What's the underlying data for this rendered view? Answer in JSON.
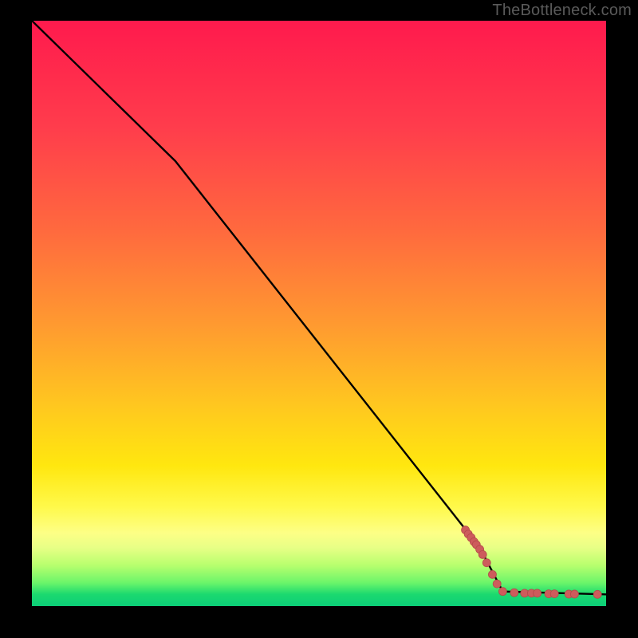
{
  "watermark": "TheBottleneck.com",
  "colors": {
    "line": "#000000",
    "marker_fill": "#cd5c5c",
    "marker_stroke": "#b54a4a",
    "bg_top": "#ff1a4d",
    "bg_mid": "#ffe70f",
    "bg_bottom": "#0cce78"
  },
  "chart_data": {
    "type": "line",
    "title": "",
    "xlabel": "",
    "ylabel": "",
    "xlim": [
      0,
      100
    ],
    "ylim": [
      0,
      100
    ],
    "grid": false,
    "legend": false,
    "series": [
      {
        "name": "curve",
        "x": [
          0,
          25,
          78,
          82,
          100
        ],
        "y": [
          100,
          76,
          10,
          2.5,
          2
        ],
        "note": "piecewise: steeper 0–25, linear 25–78, short arc 78–82, flat 82–100"
      }
    ],
    "markers": {
      "name": "highlighted-points",
      "color": "#cd5c5c",
      "points": [
        {
          "x": 75.5,
          "y": 13.0,
          "r": 5
        },
        {
          "x": 76.0,
          "y": 12.3,
          "r": 5
        },
        {
          "x": 76.5,
          "y": 11.7,
          "r": 5
        },
        {
          "x": 77.0,
          "y": 11.0,
          "r": 5
        },
        {
          "x": 77.4,
          "y": 10.5,
          "r": 5
        },
        {
          "x": 78.0,
          "y": 9.7,
          "r": 5
        },
        {
          "x": 78.5,
          "y": 8.8,
          "r": 5
        },
        {
          "x": 79.2,
          "y": 7.4,
          "r": 5
        },
        {
          "x": 80.2,
          "y": 5.4,
          "r": 5
        },
        {
          "x": 81.0,
          "y": 3.8,
          "r": 5
        },
        {
          "x": 82.0,
          "y": 2.5,
          "r": 5
        },
        {
          "x": 84.0,
          "y": 2.3,
          "r": 5
        },
        {
          "x": 85.8,
          "y": 2.2,
          "r": 5
        },
        {
          "x": 87.0,
          "y": 2.2,
          "r": 5
        },
        {
          "x": 88.0,
          "y": 2.2,
          "r": 5
        },
        {
          "x": 90.0,
          "y": 2.1,
          "r": 5
        },
        {
          "x": 91.0,
          "y": 2.1,
          "r": 5
        },
        {
          "x": 93.5,
          "y": 2.05,
          "r": 5
        },
        {
          "x": 94.5,
          "y": 2.05,
          "r": 5
        },
        {
          "x": 98.5,
          "y": 2.0,
          "r": 5
        }
      ]
    }
  }
}
